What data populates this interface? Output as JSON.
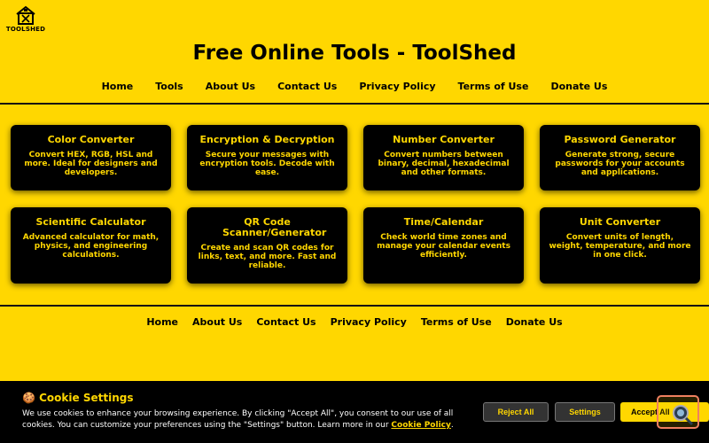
{
  "logo": {
    "text": "TOOLSHED"
  },
  "site_title": "Free Online Tools - ToolShed",
  "top_nav": [
    "Home",
    "Tools",
    "About Us",
    "Contact Us",
    "Privacy Policy",
    "Terms of Use",
    "Donate Us"
  ],
  "tools": [
    {
      "title": "Color Converter",
      "desc": "Convert HEX, RGB, HSL and more. Ideal for designers and developers."
    },
    {
      "title": "Encryption & Decryption",
      "desc": "Secure your messages with encryption tools. Decode with ease."
    },
    {
      "title": "Number Converter",
      "desc": "Convert numbers between binary, decimal, hexadecimal and other formats."
    },
    {
      "title": "Password Generator",
      "desc": "Generate strong, secure passwords for your accounts and applications."
    },
    {
      "title": "Scientific Calculator",
      "desc": "Advanced calculator for math, physics, and engineering calculations."
    },
    {
      "title": "QR Code Scanner/Generator",
      "desc": "Create and scan QR codes for links, text, and more. Fast and reliable."
    },
    {
      "title": "Time/Calendar",
      "desc": "Check world time zones and manage your calendar events efficiently."
    },
    {
      "title": "Unit Converter",
      "desc": "Convert units of length, weight, temperature, and more in one click."
    }
  ],
  "footer_nav": [
    "Home",
    "About Us",
    "Contact Us",
    "Privacy Policy",
    "Terms of Use",
    "Donate Us"
  ],
  "cookie": {
    "title": "🍪 Cookie Settings",
    "text_before": "We use cookies to enhance your browsing experience. By clicking \"Accept All\", you consent to our use of all cookies. You can customize your preferences using the \"Settings\" button. Learn more in our ",
    "policy_link": "Cookie Policy",
    "text_after": ".",
    "reject_label": "Reject All",
    "settings_label": "Settings",
    "accept_label": "Accept All"
  },
  "colors": {
    "brand_yellow": "#FFD700",
    "card_bg": "#000000"
  }
}
